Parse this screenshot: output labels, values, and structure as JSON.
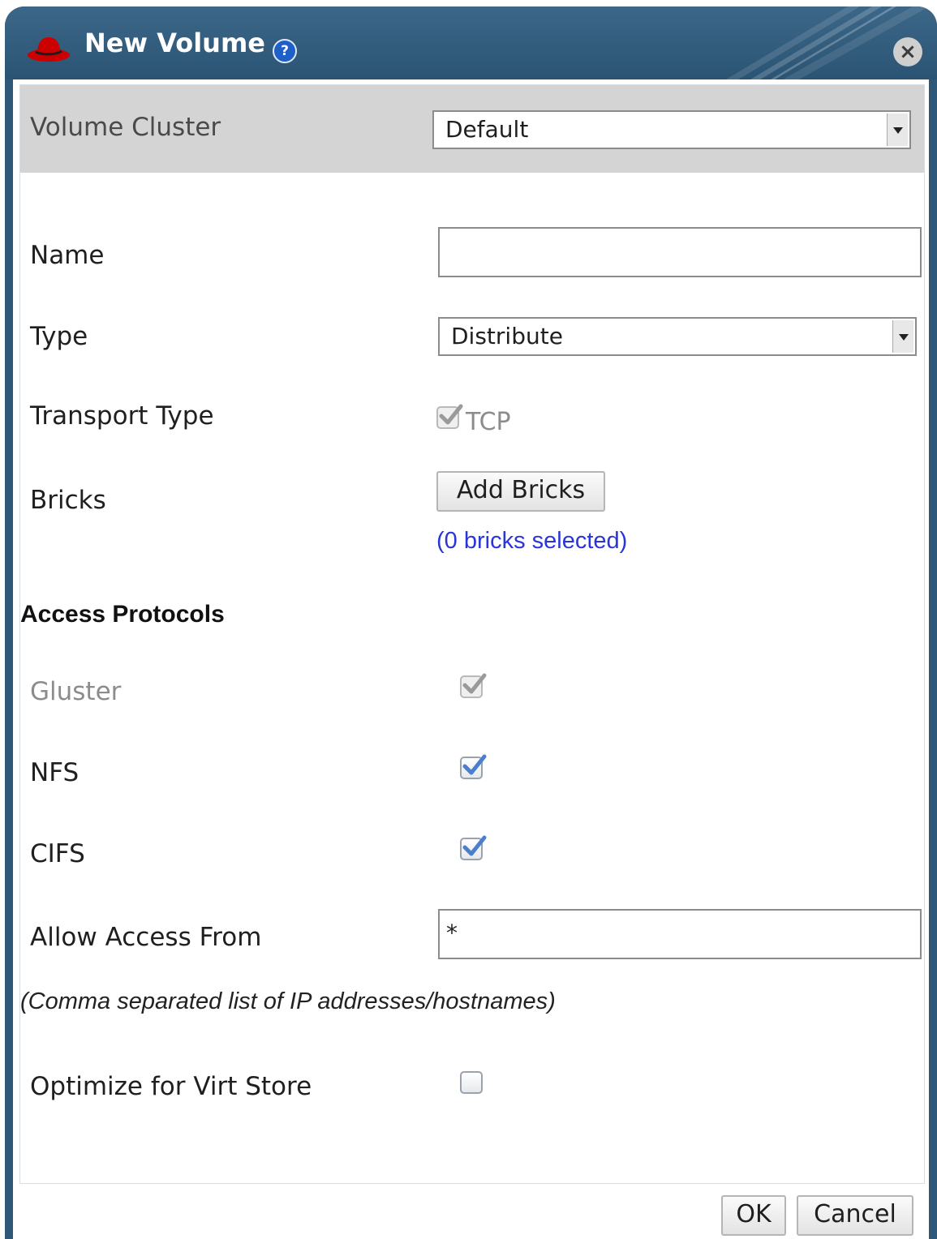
{
  "dialog": {
    "title": "New Volume",
    "help_icon": "help-icon",
    "close_icon": "close-icon",
    "colors": {
      "titlebar": "#2f5878",
      "link": "#2a35d8",
      "check": "#4a7fd0"
    }
  },
  "form": {
    "volume_cluster": {
      "label": "Volume Cluster",
      "value": "Default"
    },
    "name": {
      "label": "Name",
      "value": ""
    },
    "type": {
      "label": "Type",
      "value": "Distribute"
    },
    "transport_type": {
      "label": "Transport Type",
      "option_label": "TCP",
      "checked": true,
      "disabled": true
    },
    "bricks": {
      "label": "Bricks",
      "button_label": "Add Bricks",
      "selected_text": "(0 bricks selected)"
    },
    "access_protocols": {
      "title": "Access Protocols",
      "gluster": {
        "label": "Gluster",
        "checked": true,
        "disabled": true
      },
      "nfs": {
        "label": "NFS",
        "checked": true
      },
      "cifs": {
        "label": "CIFS",
        "checked": true
      }
    },
    "allow_access_from": {
      "label": "Allow Access From",
      "value": "*",
      "hint": "(Comma separated list of IP addresses/hostnames)"
    },
    "optimize_virt_store": {
      "label": "Optimize for Virt Store",
      "checked": false
    }
  },
  "footer": {
    "ok_label": "OK",
    "cancel_label": "Cancel"
  }
}
